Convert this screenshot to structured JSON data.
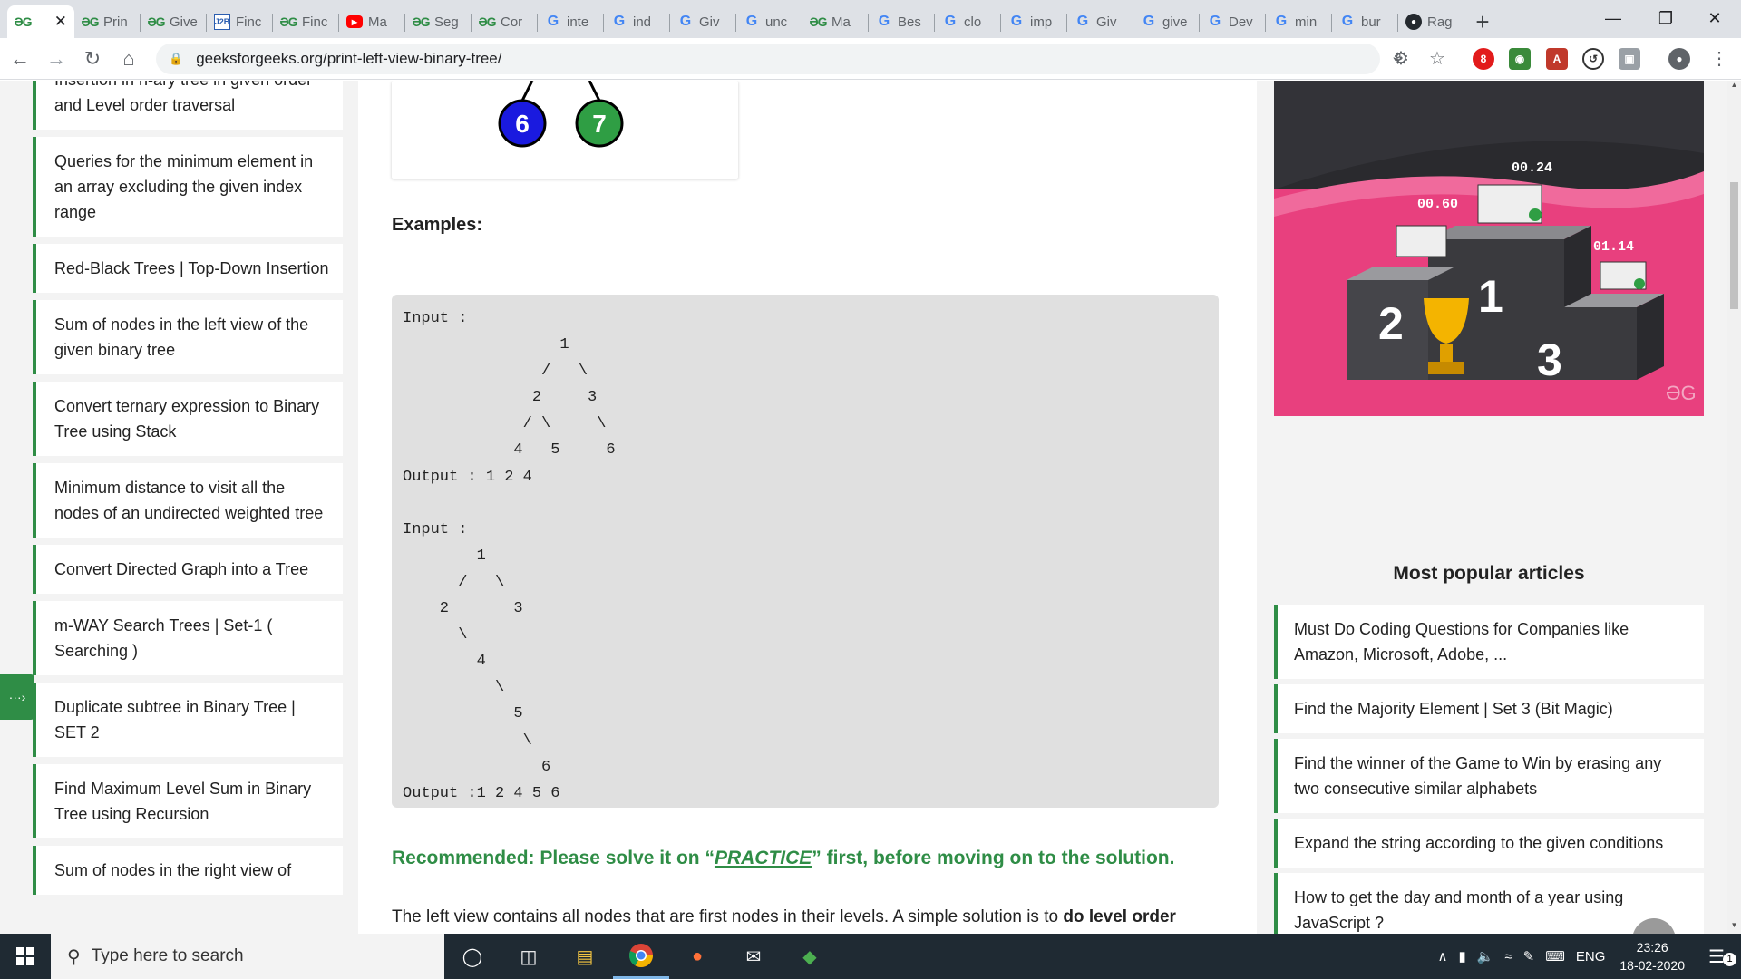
{
  "browser": {
    "tabs": [
      {
        "favicon": "gfg",
        "label": "",
        "active": true
      },
      {
        "favicon": "gfg",
        "label": "Prin"
      },
      {
        "favicon": "gfg",
        "label": "Give"
      },
      {
        "favicon": "j2b",
        "label": "Finc"
      },
      {
        "favicon": "gfg",
        "label": "Finc"
      },
      {
        "favicon": "yt",
        "label": "Ma"
      },
      {
        "favicon": "gfg",
        "label": "Seg"
      },
      {
        "favicon": "gfg",
        "label": "Cor"
      },
      {
        "favicon": "g",
        "label": "inte"
      },
      {
        "favicon": "g",
        "label": "ind"
      },
      {
        "favicon": "g",
        "label": "Giv"
      },
      {
        "favicon": "g",
        "label": "unc"
      },
      {
        "favicon": "gfg",
        "label": "Ma"
      },
      {
        "favicon": "g",
        "label": "Bes"
      },
      {
        "favicon": "g",
        "label": "clo"
      },
      {
        "favicon": "g",
        "label": "imp"
      },
      {
        "favicon": "g",
        "label": "Giv"
      },
      {
        "favicon": "g",
        "label": "give"
      },
      {
        "favicon": "g",
        "label": "Dev"
      },
      {
        "favicon": "g",
        "label": "min"
      },
      {
        "favicon": "g",
        "label": "bur"
      },
      {
        "favicon": "gh",
        "label": "Rag"
      }
    ],
    "active_tab_close": "✕",
    "new_tab": "+",
    "favicon_text": {
      "gfg": "ƏG",
      "g": "G",
      "j2b": "J2B",
      "yt": "▶",
      "gh": "●"
    },
    "url": "geeksforgeeks.org/print-left-view-binary-tree/",
    "extension_badge": "8"
  },
  "sidebar": {
    "items": [
      "Insertion in n-ary tree in given order and Level order traversal",
      "Queries for the minimum element in an array excluding the given index range",
      "Red-Black Trees | Top-Down Insertion",
      "Sum of nodes in the left view of the given binary tree",
      "Convert ternary expression to Binary Tree using Stack",
      "Minimum distance to visit all the nodes of an undirected weighted tree",
      "Convert Directed Graph into a Tree",
      "m-WAY Search Trees | Set-1 ( Searching )",
      "Duplicate subtree in Binary Tree | SET 2",
      "Find Maximum Level Sum in Binary Tree using Recursion",
      "Sum of nodes in the right view of"
    ],
    "arrow": "···›"
  },
  "article": {
    "tree_nodes": [
      {
        "label": "6",
        "color": "#1a1adf"
      },
      {
        "label": "7",
        "color": "#2f9e44"
      }
    ],
    "examples_heading": "Examples:",
    "code": "Input :\n                 1\n               /   \\\n              2     3\n             / \\     \\\n            4   5     6\nOutput : 1 2 4\n\nInput :\n        1\n      /   \\\n    2       3\n      \\\n        4\n          \\\n            5\n             \\\n               6\nOutput :1 2 4 5 6",
    "recommend_prefix": "Recommended: Please solve it on “",
    "recommend_link": "PRACTICE",
    "recommend_suffix": "” first, before moving on to the solution.",
    "paragraph_text": "The left view contains all nodes that are first nodes in their levels. A simple solution is to ",
    "paragraph_bold": "do level order"
  },
  "ad": {
    "timers": [
      "00.24",
      "00.60",
      "01.14"
    ],
    "ranks": [
      "1",
      "2",
      "3"
    ],
    "logo": "ƏG"
  },
  "popular": {
    "title": "Most popular articles",
    "items": [
      "Must Do Coding Questions for Companies like Amazon, Microsoft, Adobe, ...",
      "Find the Majority Element | Set 3 (Bit Magic)",
      "Find the winner of the Game to Win by erasing any two consecutive similar alphabets",
      "Expand the string according to the given conditions",
      "How to get the day and month of a year using JavaScript ?"
    ]
  },
  "taskbar": {
    "search_placeholder": "Type here to search",
    "language": "ENG",
    "time": "23:26",
    "date": "18-02-2020",
    "notification_count": "1"
  },
  "colors": {
    "brand_green": "#2f8d46",
    "ad_pink": "#e8407e"
  }
}
